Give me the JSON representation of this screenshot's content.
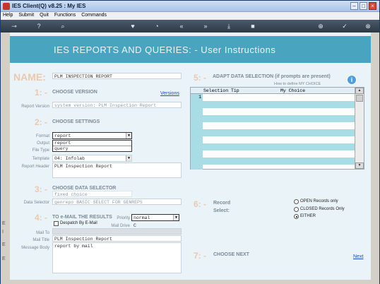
{
  "window": {
    "title": "IES Client(Q) v8.25 : My IES"
  },
  "menu": [
    "Help",
    "Submit",
    "Quit",
    "Functions",
    "Commands"
  ],
  "toolbar_icons": [
    "key-icon",
    "help-icon",
    "search-icon",
    "heart-icon",
    "history-icon",
    "rewind-icon",
    "forward-icon",
    "download-icon",
    "stop-icon",
    "add-icon",
    "check-icon",
    "close-icon"
  ],
  "banner": {
    "title": "IES REPORTS AND QUERIES: -   User Instructions"
  },
  "name": {
    "label": "NAME:",
    "value": "PLM INSPECTION REPORT"
  },
  "section1": {
    "num": "1: -",
    "title": "CHOOSE VERSION",
    "link": "Versions",
    "version_label": "Report Version",
    "version_value": "system version: PLM Inspection Report"
  },
  "section2": {
    "num": "2: -",
    "title": "CHOOSE SETTINGS",
    "format_label": "Format",
    "format_value": "report",
    "format_options": [
      "report",
      "query"
    ],
    "output_label": "Output",
    "filetype_label": "File Type",
    "template_label": "Template",
    "template_value": "04: Infolab",
    "header_label": "Report Header",
    "header_value": "PLM Inspection Report"
  },
  "section3": {
    "num": "3: -",
    "title": "CHOOSE DATA SELECTOR",
    "choice_value": "fixed choice",
    "selector_label": "Data Selector",
    "selector_value": "genrepo BASIC SELECT FOR GENREPS"
  },
  "section4": {
    "num": "4: -",
    "title": "TO e-MAIL THE RESULTS",
    "despatch_label": "Despatch By E-Mail",
    "priority_label": "Priority",
    "priority_value": "normal",
    "maildrive_label": "Mail Drive",
    "maildrive_value": "C",
    "mailto_label": "Mail To",
    "mailtitle_label": "Mail Title",
    "mailtitle_value": "PLM Inspection Report",
    "body_label": "Message Body",
    "body_value": "report by mail"
  },
  "section5": {
    "num": "5: -",
    "title": "ADAPT DATA SELECTION (if prompts are present)",
    "hint": "How to define MY CHOICE",
    "col1": "Selection Tip",
    "col2": "My Choice",
    "row1": "1"
  },
  "section6": {
    "num": "6: -",
    "record_label": "Record",
    "select_label": "Select:",
    "options": [
      "OPEN Records only",
      "CLOSED Records Only",
      "EITHER"
    ],
    "selected": "EITHER"
  },
  "section7": {
    "num": "7: -",
    "title": "CHOOSE NEXT",
    "link": "Next"
  },
  "colors": {
    "banner": "#49a5bf",
    "accent": "#e9c9b0",
    "grid_row": "#a9dde6"
  }
}
